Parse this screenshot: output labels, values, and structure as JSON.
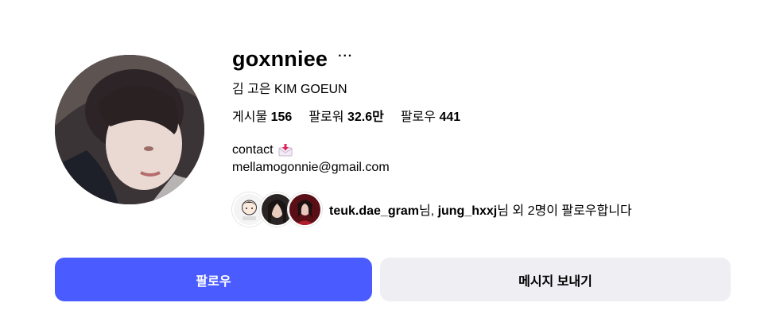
{
  "profile": {
    "username": "goxnniee",
    "more_label": "···",
    "full_name": "김 고은 KIM GOEUN",
    "stats": {
      "posts_label": "게시물",
      "posts_value": "156",
      "followers_label": "팔로워",
      "followers_value": "32.6만",
      "following_label": "팔로우",
      "following_value": "441"
    },
    "bio": {
      "line1": "contact",
      "line1_icon": "envelope-arrow-emoji",
      "line2": "mellamogonnie@gmail.com"
    },
    "followed_by": {
      "user1": "teuk.dae_gram",
      "suffix1": "님, ",
      "user2": "jung_hxxj",
      "suffix2": "님 외 2명이 팔로우합니다"
    }
  },
  "actions": {
    "follow_label": "팔로우",
    "message_label": "메시지 보내기"
  },
  "colors": {
    "follow_button": "#4a5cff",
    "message_button": "#efeff3"
  }
}
